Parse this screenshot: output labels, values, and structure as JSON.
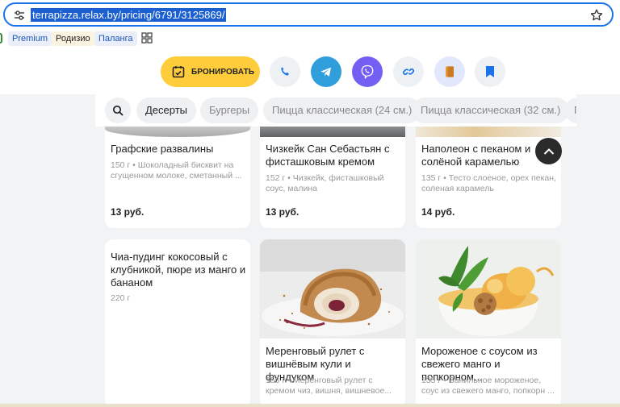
{
  "browser": {
    "url": "terrapizza.relax.by/pricing/6791/3125869/",
    "bookmarks": [
      {
        "label": "Premium"
      },
      {
        "label": "Родизио"
      },
      {
        "label": "Паланга"
      }
    ]
  },
  "actions": {
    "book_label": "БРОНИРОВАТЬ",
    "accent_color": "#ffcd3c"
  },
  "categories": {
    "active": "Десерты",
    "items": [
      "Десерты",
      "Бургеры",
      "Пицца классическая (24 см.)",
      "Пицца классическая (32 см.)",
      "П"
    ]
  },
  "cards": [
    {
      "title": "Графские развалины",
      "desc": "150 г • Шоколадный бисквит на сгущенном молоке, сметанный ...",
      "price": "13 руб."
    },
    {
      "title": "Чизкейк Сан Себастьян с фисташковым кремом",
      "desc": "152 г • Чизкейк, фисташковый соус, малина",
      "price": "13 руб."
    },
    {
      "title": "Наполеон с пеканом и солёной карамелью",
      "desc": "135 г • Тесто слоеное, орех пекан, соленая карамель",
      "price": "14 руб."
    },
    {
      "title": "Чиа-пудинг кокосовый с клубникой, пюре из манго и бананом",
      "desc": "220 г"
    },
    {
      "title": "Меренговый рулет с вишнёвым кули и фундуком",
      "desc": "156 г • Меренговый рулет с кремом чиз, вишня, вишневое..."
    },
    {
      "title": "Мороженое с соусом из свежего манго и попкорном...",
      "desc": "135 г • Ванильное мороженое, соус из свежего манго, попкорн ..."
    }
  ]
}
